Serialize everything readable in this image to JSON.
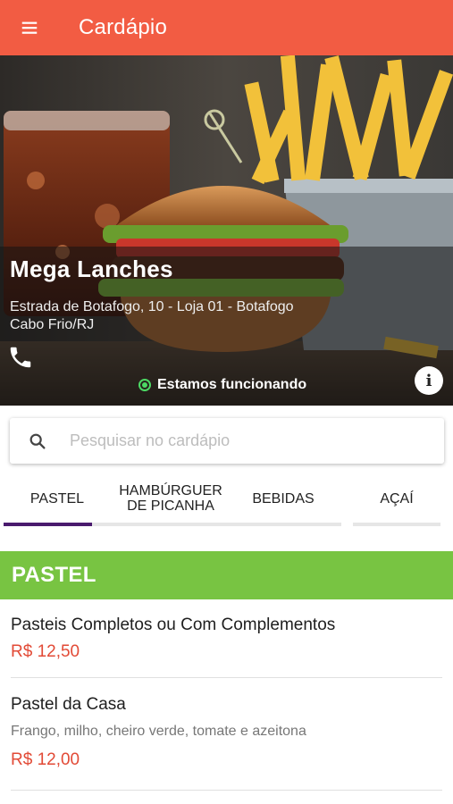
{
  "appbar": {
    "title": "Cardápio",
    "menu_icon": "menu-icon"
  },
  "store": {
    "name": "Mega Lanches",
    "address_line1": "Estrada de Botafogo, 10 - Loja 01 - Botafogo",
    "address_line2": "Cabo Frio/RJ",
    "status": "Estamos funcionando",
    "status_color": "#4cd964"
  },
  "search": {
    "placeholder": "Pesquisar no cardápio"
  },
  "tabs": [
    {
      "label": "PASTEL"
    },
    {
      "label": "HAMBÚRGUER DE PICANHA"
    },
    {
      "label": "BEBIDAS"
    },
    {
      "label": "AÇAÍ"
    }
  ],
  "active_tab_color": "#4a1a6e",
  "section": {
    "title": "PASTEL",
    "color": "#78c442"
  },
  "items": [
    {
      "name": "Pasteis Completos ou Com Complementos",
      "price": "R$ 12,50"
    },
    {
      "name": "Pastel da Casa",
      "description": "Frango, milho, cheiro verde, tomate e azeitona",
      "price": "R$ 12,00"
    }
  ],
  "colors": {
    "appbar": "#f25c43",
    "price": "#e24a36"
  }
}
